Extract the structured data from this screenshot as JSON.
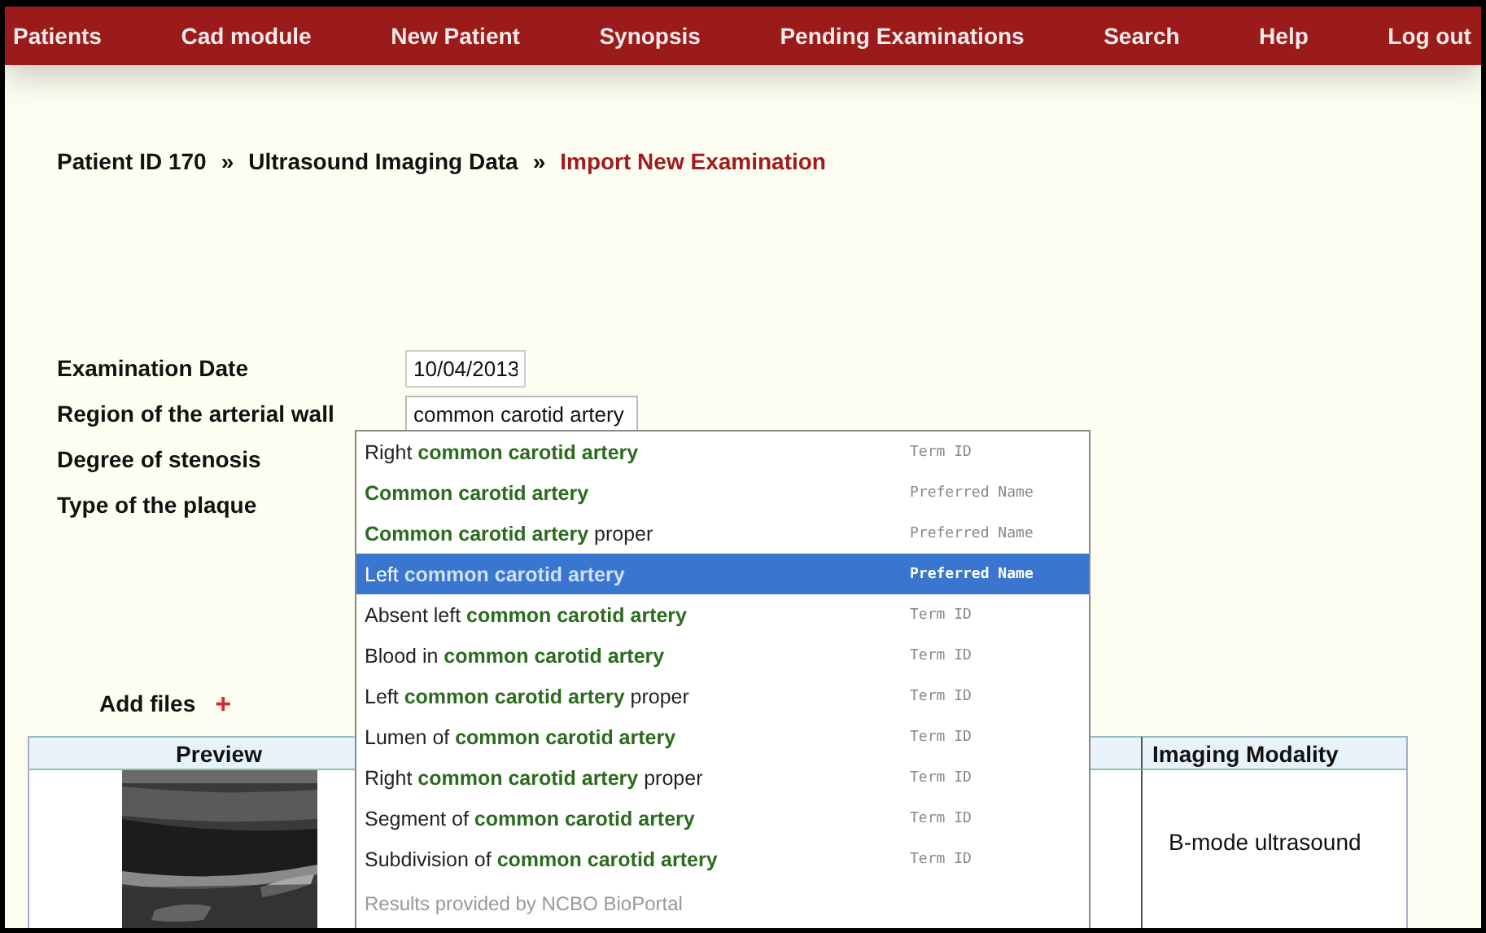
{
  "nav": [
    {
      "label": "Patients"
    },
    {
      "label": "Cad module"
    },
    {
      "label": "New Patient"
    },
    {
      "label": "Synopsis"
    },
    {
      "label": "Pending Examinations"
    },
    {
      "label": "Search"
    },
    {
      "label": "Help"
    },
    {
      "label": "Log out"
    }
  ],
  "breadcrumb": [
    {
      "kind": "link",
      "text": "Patient ID 170"
    },
    {
      "kind": "sep",
      "text": "»"
    },
    {
      "kind": "link",
      "text": "Ultrasound Imaging Data"
    },
    {
      "kind": "sep",
      "text": "»"
    },
    {
      "kind": "current",
      "text": "Import New Examination"
    }
  ],
  "form": [
    {
      "label": "Examination Date",
      "kind": "date",
      "value": "10/04/2013"
    },
    {
      "label": "Region of the arterial wall",
      "kind": "text",
      "value": "common carotid artery"
    },
    {
      "label": "Degree of stenosis",
      "kind": "none"
    },
    {
      "label": "Type of the plaque",
      "kind": "none"
    }
  ],
  "suggestions": {
    "items": [
      {
        "text": "Right **common carotid artery**",
        "type": "Term ID",
        "selected": false
      },
      {
        "text": "**Common carotid artery**",
        "type": "Preferred Name",
        "selected": false
      },
      {
        "text": "**Common carotid artery** proper",
        "type": "Preferred Name",
        "selected": false
      },
      {
        "text": "Left **common carotid artery**",
        "type": "Preferred Name",
        "selected": true
      },
      {
        "text": "Absent left **common carotid artery**",
        "type": "Term ID",
        "selected": false
      },
      {
        "text": "Blood in **common carotid artery**",
        "type": "Term ID",
        "selected": false
      },
      {
        "text": "Left **common carotid artery** proper",
        "type": "Term ID",
        "selected": false
      },
      {
        "text": "Lumen of **common carotid artery**",
        "type": "Term ID",
        "selected": false
      },
      {
        "text": "Right **common carotid artery** proper",
        "type": "Term ID",
        "selected": false
      },
      {
        "text": "Segment of **common carotid artery**",
        "type": "Term ID",
        "selected": false
      },
      {
        "text": "Subdivision of **common carotid artery**",
        "type": "Term ID",
        "selected": false
      }
    ],
    "footer": "Results provided by NCBO BioPortal"
  },
  "add_files": {
    "label": "Add files",
    "icon": "+"
  },
  "table": {
    "columns": [
      "Preview",
      "Imaging Modality"
    ],
    "rows": [
      {
        "modality": "B-mode ultrasound"
      }
    ]
  }
}
